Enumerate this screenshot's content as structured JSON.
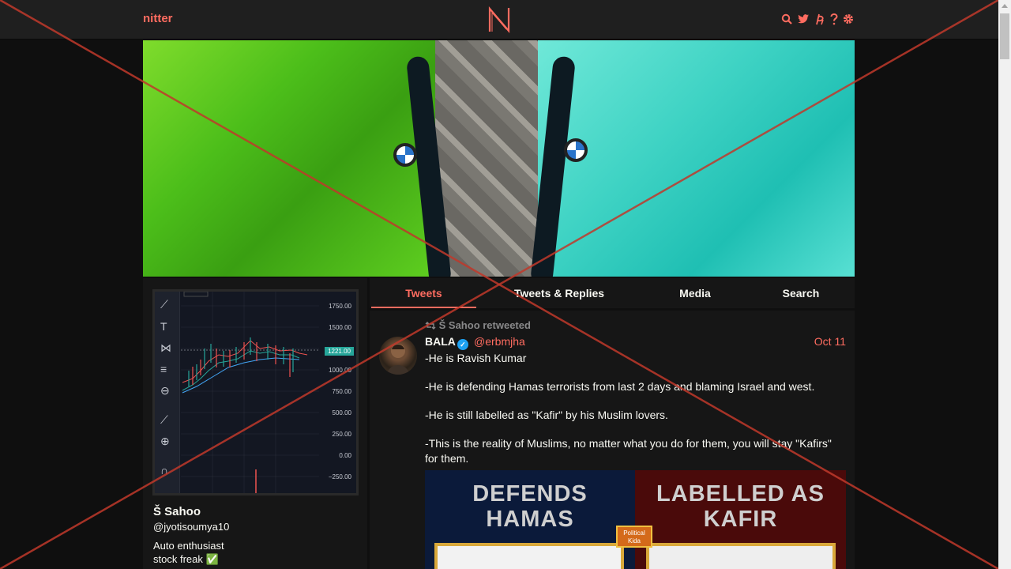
{
  "navbar": {
    "brand": "nitter",
    "logo_letter": "N",
    "icons": [
      "search-icon",
      "twitter-bird-icon",
      "rss-icon",
      "help-icon",
      "gear-icon"
    ]
  },
  "profile": {
    "fullname": "Š Sahoo",
    "username": "@jyotisoumya10",
    "bio_line1": "Auto enthusiast",
    "bio_line2": "stock freak ✅",
    "chart_axis": [
      "1750.00",
      "1500.00",
      "1221.00",
      "1000.00",
      "750.00",
      "500.00",
      "250.00",
      "0.00",
      "−250.00"
    ],
    "chart_price": "1221.00"
  },
  "tabs": [
    {
      "label": "Tweets",
      "active": true
    },
    {
      "label": "Tweets & Replies",
      "active": false
    },
    {
      "label": "Media",
      "active": false
    },
    {
      "label": "Search",
      "active": false
    }
  ],
  "tweet": {
    "retweet_header": "Š Sahoo retweeted",
    "author_name": "BALA",
    "author_handle": "@erbmjha",
    "date": "Oct 11",
    "body": [
      "-He is Ravish Kumar",
      "-He is defending Hamas terrorists from last 2 days and blaming Israel and west.",
      "-He is still labelled as \"Kafir\" by his Muslim lovers.",
      "-This is the reality of Muslims, no matter what you do for them, you will stay  \"Kafirs\" for them."
    ],
    "media_left_text": "DEFENDS\nHAMAS",
    "media_right_text": "LABELLED AS\nKAFIR",
    "media_badge": "Political Kida"
  },
  "colors": {
    "accent": "#ff6c60",
    "background": "#0f0f0f",
    "panel": "#161616",
    "navbar": "#1f1f1f",
    "overlay_x": "#c0392b"
  }
}
